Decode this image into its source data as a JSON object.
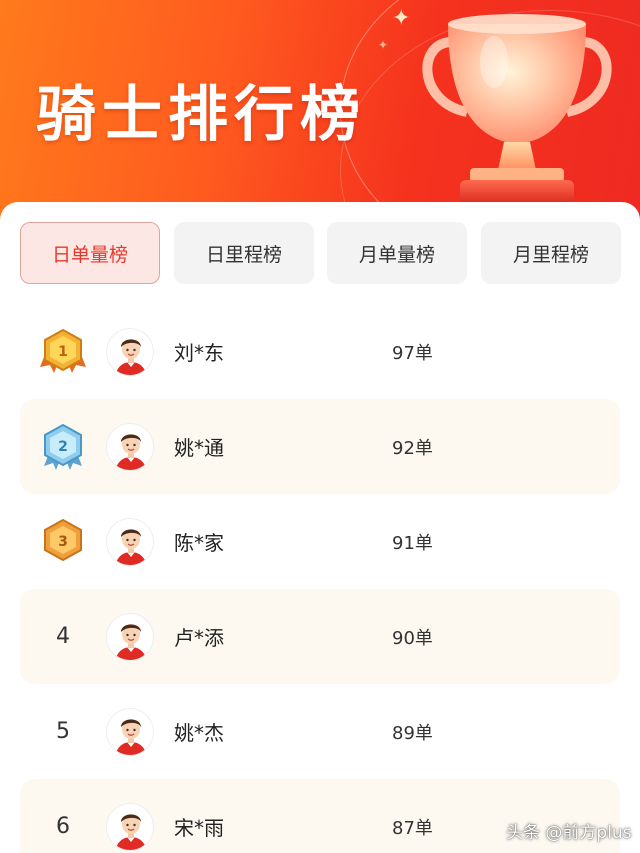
{
  "banner": {
    "title": "骑士排行榜"
  },
  "tabs": [
    {
      "label": "日单量榜",
      "active": true
    },
    {
      "label": "日里程榜",
      "active": false
    },
    {
      "label": "月单量榜",
      "active": false
    },
    {
      "label": "月里程榜",
      "active": false
    }
  ],
  "riders": [
    {
      "rank": "1",
      "badge": "gold-medal-icon",
      "name": "刘*东",
      "count": "97单"
    },
    {
      "rank": "2",
      "badge": "silver-medal-icon",
      "name": "姚*通",
      "count": "92单"
    },
    {
      "rank": "3",
      "badge": "bronze-medal-icon",
      "name": "陈*家",
      "count": "91单"
    },
    {
      "rank": "4",
      "badge": null,
      "name": "卢*添",
      "count": "90单"
    },
    {
      "rank": "5",
      "badge": null,
      "name": "姚*杰",
      "count": "89单"
    },
    {
      "rank": "6",
      "badge": null,
      "name": "宋*雨",
      "count": "87单"
    }
  ],
  "watermark": "头条 @前方plus",
  "colors": {
    "accent": "#e8382c",
    "banner_start": "#ff7a1c",
    "banner_end": "#ee2a22",
    "alt_row": "#fdf9f1",
    "gold": "#f2b233",
    "silver": "#7cc3e8",
    "bronze": "#f0a03a"
  }
}
